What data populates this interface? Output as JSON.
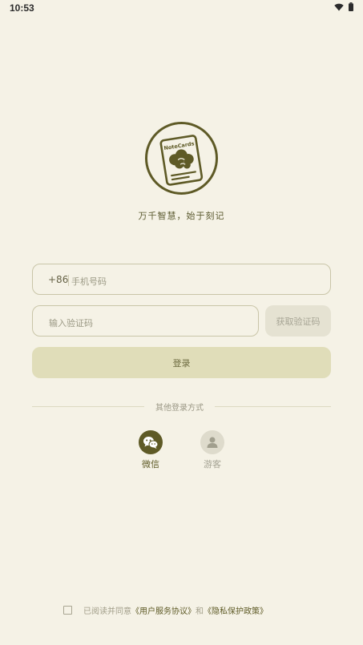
{
  "status_bar": {
    "time": "10:53",
    "icons": [
      "wifi-icon",
      "battery-icon"
    ]
  },
  "logo": {
    "text": "NoteCards",
    "icon": "notecards-logo"
  },
  "slogan": "万千智慧，始于刻记",
  "phone_field": {
    "country_code": "+86",
    "placeholder": "手机号码"
  },
  "code_field": {
    "placeholder": "输入验证码"
  },
  "get_code_label": "获取验证码",
  "login_label": "登录",
  "other_login": {
    "label": "其他登录方式",
    "options": [
      {
        "label": "微信",
        "icon": "wechat-icon"
      },
      {
        "label": "游客",
        "icon": "guest-icon"
      }
    ]
  },
  "agreement": {
    "prefix": "已阅读并同意",
    "user_agreement": "《用户服务协议》",
    "and": "和",
    "privacy_policy": "《隐私保护政策》"
  },
  "colors": {
    "background": "#f5f2e6",
    "primary": "#5e5a26",
    "login_button": "#e0ddb9"
  }
}
